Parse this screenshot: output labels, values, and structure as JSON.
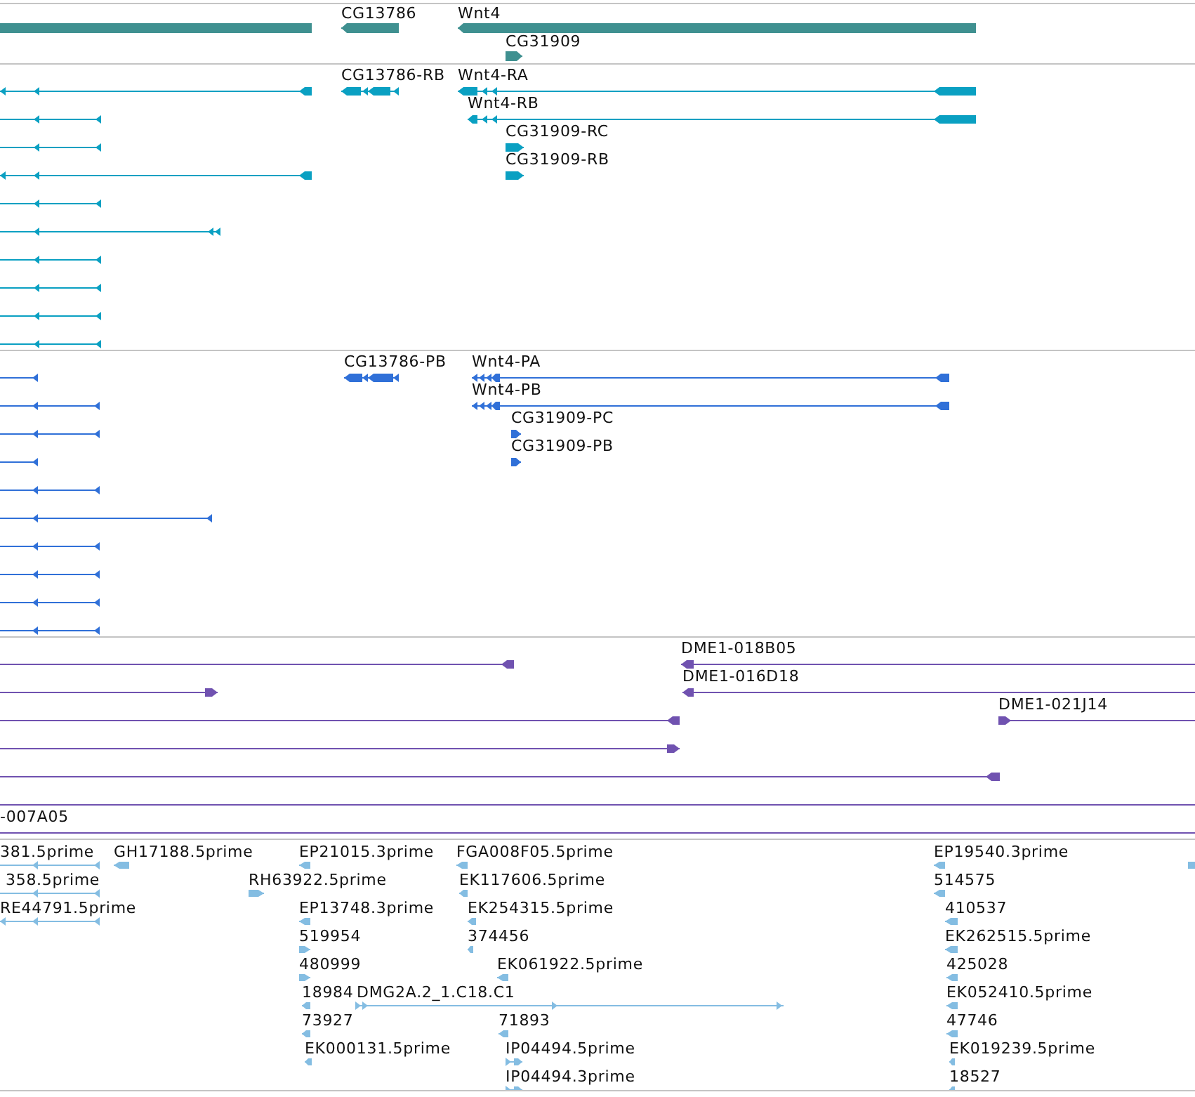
{
  "tracks": [
    {
      "kind": "gene",
      "features": [
        {
          "label": "CG13786",
          "reverse": true
        },
        {
          "label": "Wnt4",
          "reverse": true
        },
        {
          "label": "CG31909",
          "reverse": false
        }
      ]
    },
    {
      "kind": "transcript",
      "features": [
        {
          "label": "CG13786-RB",
          "reverse": true
        },
        {
          "label": "Wnt4-RA",
          "reverse": true
        },
        {
          "label": "Wnt4-RB",
          "reverse": true
        },
        {
          "label": "CG31909-RC",
          "reverse": false
        },
        {
          "label": "CG31909-RB",
          "reverse": false
        }
      ]
    },
    {
      "kind": "protein",
      "features": [
        {
          "label": "CG13786-PB",
          "reverse": true
        },
        {
          "label": "Wnt4-PA",
          "reverse": true
        },
        {
          "label": "Wnt4-PB",
          "reverse": true
        },
        {
          "label": "CG31909-PC",
          "reverse": false
        },
        {
          "label": "CG31909-PB",
          "reverse": false
        }
      ]
    },
    {
      "kind": "clone",
      "features": [
        {
          "label": "DME1-018B05",
          "reverse": true
        },
        {
          "label": "DME1-016D18",
          "reverse": true
        },
        {
          "label": "DME1-021J14",
          "reverse": false
        },
        {
          "label": "-007A05"
        }
      ]
    },
    {
      "kind": "est",
      "features": [
        {
          "label": "381.5prime",
          "reverse": true
        },
        {
          "label": "358.5prime",
          "reverse": true
        },
        {
          "label": "RE44791.5prime",
          "reverse": true
        },
        {
          "label": "GH17188.5prime",
          "reverse": true
        },
        {
          "label": "RH63922.5prime",
          "reverse": false
        },
        {
          "label": "EP21015.3prime",
          "reverse": true
        },
        {
          "label": "EP13748.3prime",
          "reverse": true
        },
        {
          "label": "519954",
          "reverse": false
        },
        {
          "label": "480999",
          "reverse": false
        },
        {
          "label": "18984",
          "reverse": true
        },
        {
          "label": "DMG2A.2_1.C18.C1",
          "reverse": false
        },
        {
          "label": "73927",
          "reverse": true
        },
        {
          "label": "EK000131.5prime",
          "reverse": true
        },
        {
          "label": "FGA008F05.5prime",
          "reverse": true
        },
        {
          "label": "EK117606.5prime",
          "reverse": true
        },
        {
          "label": "EK254315.5prime",
          "reverse": true
        },
        {
          "label": "374456",
          "reverse": true
        },
        {
          "label": "EK061922.5prime",
          "reverse": true
        },
        {
          "label": "71893",
          "reverse": true
        },
        {
          "label": "IP04494.5prime",
          "reverse": false
        },
        {
          "label": "IP04494.3prime",
          "reverse": false
        },
        {
          "label": "EP19540.3prime",
          "reverse": true
        },
        {
          "label": "514575",
          "reverse": true
        },
        {
          "label": "410537",
          "reverse": true
        },
        {
          "label": "EK262515.5prime",
          "reverse": true
        },
        {
          "label": "425028",
          "reverse": true
        },
        {
          "label": "EK052410.5prime",
          "reverse": true
        },
        {
          "label": "47746",
          "reverse": true
        },
        {
          "label": "EK019239.5prime",
          "reverse": true
        },
        {
          "label": "18527",
          "reverse": true
        }
      ]
    }
  ]
}
